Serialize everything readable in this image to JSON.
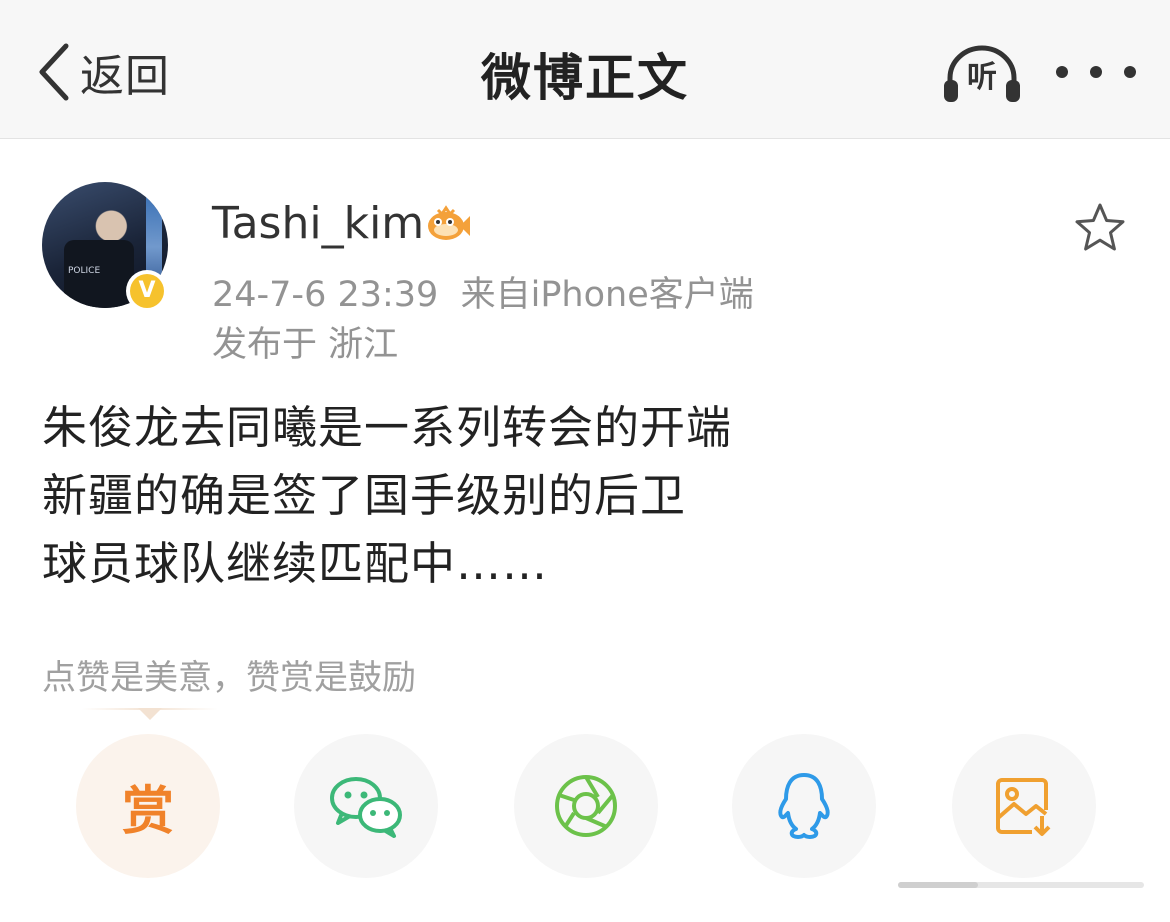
{
  "navbar": {
    "back_label": "返回",
    "title": "微博正文",
    "listen_label": "听"
  },
  "author": {
    "username": "Tashi_kim",
    "verified_mark": "V",
    "avatar_text": "POLICE",
    "date": "24-7-6 23:39",
    "source": "来自iPhone客户端",
    "location": "发布于 浙江"
  },
  "post": {
    "lines": [
      "朱俊龙去同曦是一系列转会的开端",
      "新疆的确是签了国手级别的后卫",
      "球员球队继续匹配中……"
    ]
  },
  "reward": {
    "tip": "点赞是美意，赞赏是鼓励",
    "button_char": "赏"
  },
  "icons": {
    "back": "chevron-left-icon",
    "listen": "headphones-icon",
    "more": "more-dots-icon",
    "favorite": "star-outline-icon",
    "wechat": "wechat-icon",
    "moments": "moments-aperture-icon",
    "qq": "qq-penguin-icon",
    "save_image": "save-image-icon"
  },
  "colors": {
    "nav_bg": "#f7f7f7",
    "reward_orange": "#f0822a",
    "wechat_green": "#3cb878",
    "moments_green": "#6cc24a",
    "qq_blue": "#2e9ae8",
    "save_orange": "#f0a030",
    "verified_yellow": "#f6c22d",
    "meta_gray": "#939393"
  }
}
